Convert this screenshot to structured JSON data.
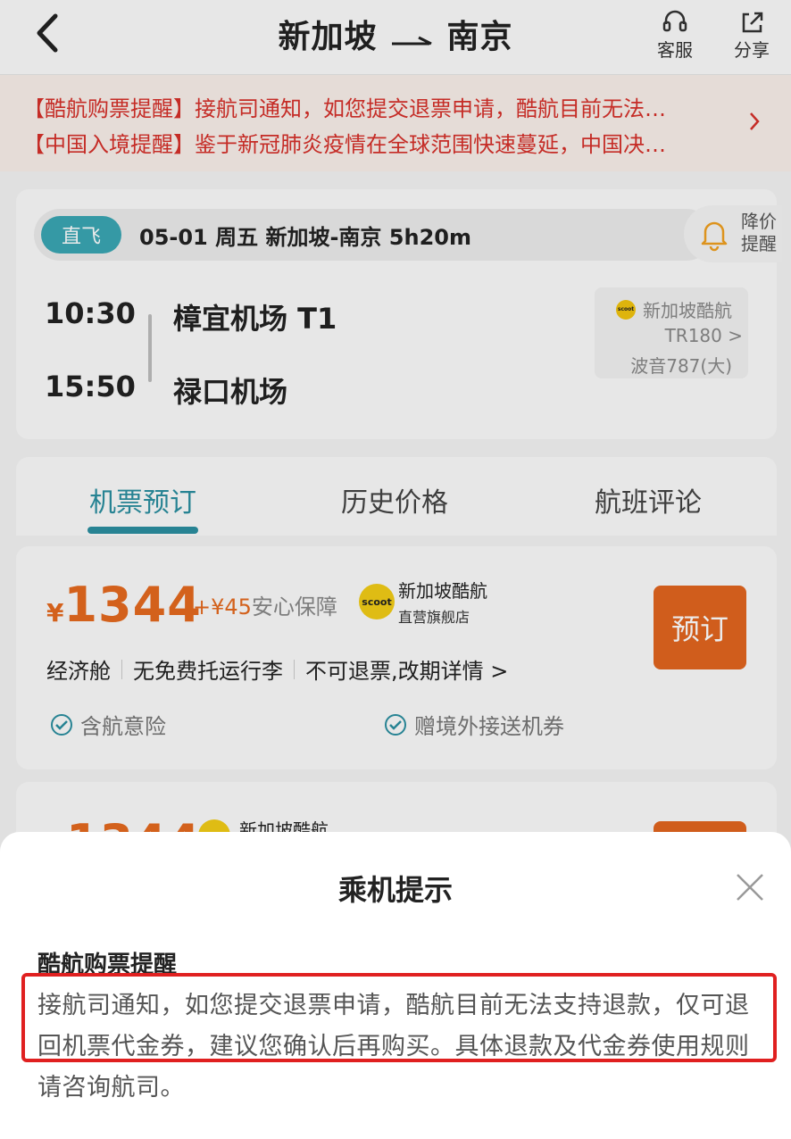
{
  "header": {
    "title_from": "新加坡",
    "title_to": "南京",
    "service_label": "客服",
    "share_label": "分享"
  },
  "notices": [
    "【酷航购票提醒】接航司通知，如您提交退票申请，酷航目前无法…",
    "【中国入境提醒】鉴于新冠肺炎疫情在全球范围快速蔓延，中国决…"
  ],
  "flight": {
    "badge": "直飞",
    "summary": "05-01 周五 新加坡-南京 5h20m",
    "price_alert": "降价提醒",
    "dep_time": "10:30",
    "arr_time": "15:50",
    "dep_airport": "樟宜机场 T1",
    "arr_airport": "禄口机场",
    "airline": "新加坡酷航",
    "flight_no": "TR180 >",
    "aircraft": "波音787(大)"
  },
  "tabs": [
    {
      "label": "机票预订",
      "active": true
    },
    {
      "label": "历史价格",
      "active": false
    },
    {
      "label": "航班评论",
      "active": false
    }
  ],
  "offer": {
    "currency": "¥",
    "price": "1344",
    "addon_price": "+¥45",
    "addon_label": "安心保障",
    "logo_text": "scoot",
    "shop_name": "新加坡酷航",
    "shop_sub": "直营旗舰店",
    "book_label": "预订",
    "cabin": "经济舱",
    "baggage": "无免费托运行李",
    "refund": "不可退票,改期详情 >",
    "perk1": "含航意险",
    "perk2": "赠境外接送机券"
  },
  "offer2": {
    "price": "1344",
    "shop_name": "新加坡酷航"
  },
  "sheet": {
    "title": "乘机提示",
    "heading": "酷航购票提醒",
    "body": "接航司通知，如您提交退票申请，酷航目前无法支持退款，仅可退回机票代金券，建议您确认后再购买。具体退款及代金券使用规则请咨询航司。"
  },
  "colors": {
    "accent": "#2b8fa0",
    "price": "#e56a1f",
    "notice": "#d6302a",
    "highlight": "#e02020"
  }
}
